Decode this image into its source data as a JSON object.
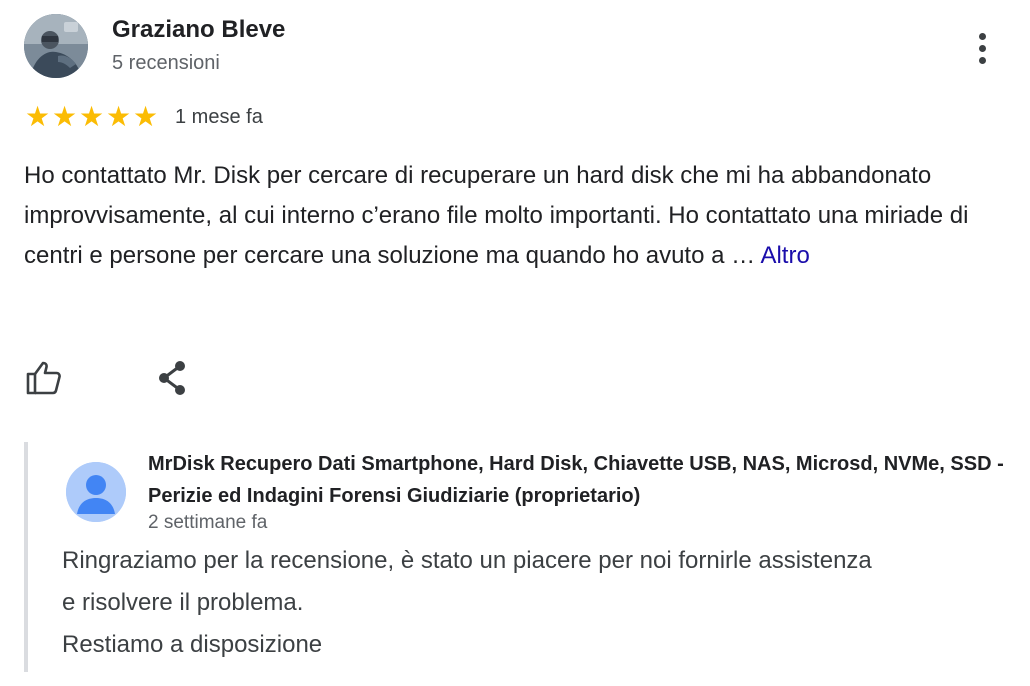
{
  "review": {
    "author": {
      "name": "Graziano Bleve",
      "reviews_count": "5 recensioni",
      "avatar_icon": "user-photo"
    },
    "menu_icon": "more-vert-icon",
    "rating": {
      "value": 5,
      "max": 5,
      "star_glyph": "★",
      "star_color": "#fbbc04"
    },
    "date": "1 mese fa",
    "text": "Ho contattato Mr. Disk per cercare di recuperare un hard disk che mi ha abbandonato improvvisamente, al cui interno c’erano file molto importanti. Ho contattato una miriade di centri e persone per cercare una soluzione ma quando ho avuto a … ",
    "more_link": "Altro",
    "actions": {
      "like_icon": "thumb-up-icon",
      "share_icon": "share-icon"
    }
  },
  "owner_reply": {
    "name": "MrDisk Recupero Dati Smartphone, Hard Disk, Chiavette USB, NAS, Microsd, NVMe, SSD - Perizie ed Indagini Forensi Giudiziarie (proprietario)",
    "date": "2 settimane fa",
    "avatar_icon": "default-profile-icon",
    "lines": [
      "Ringraziamo per la recensione, è stato un piacere per noi fornirle assistenza",
      "e risolvere il problema.",
      "Restiamo a disposizione"
    ]
  },
  "colors": {
    "link": "#1a0dab",
    "reply_border": "#dadce0",
    "owner_avatar_bg": "#aecbfa",
    "owner_avatar_fg": "#4285f4"
  }
}
